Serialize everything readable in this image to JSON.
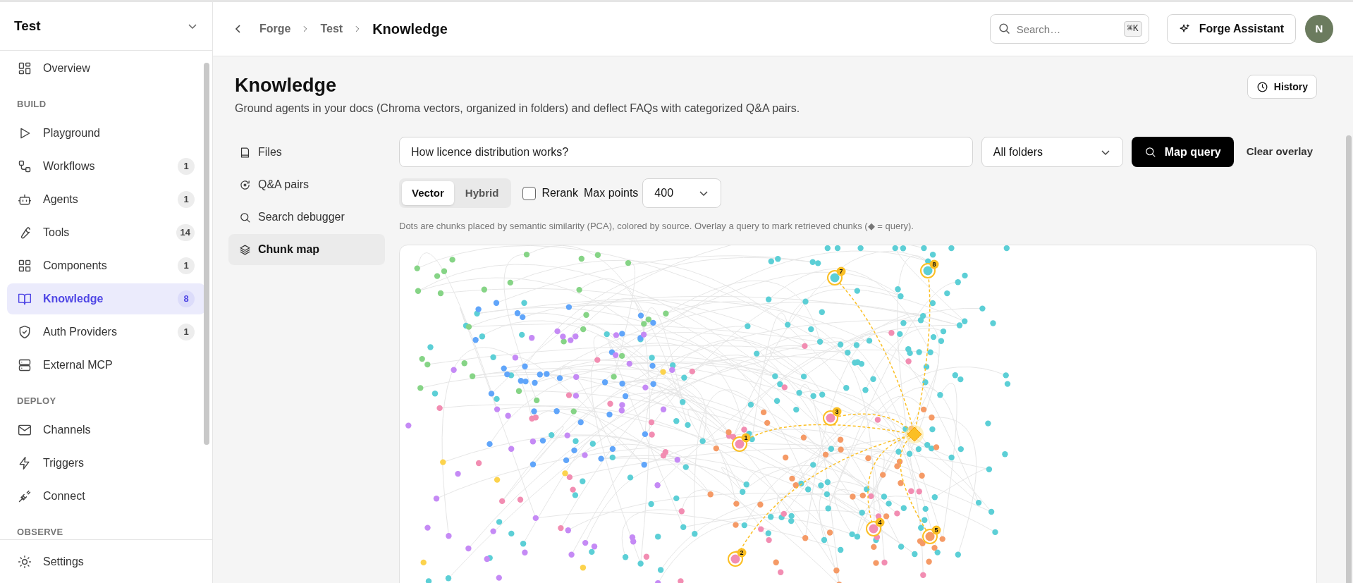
{
  "sidebar": {
    "workspace": "Test",
    "nav": [
      {
        "kind": "item",
        "label": "Overview",
        "selected": false
      },
      {
        "kind": "section",
        "label": "BUILD"
      },
      {
        "kind": "item",
        "label": "Playground",
        "selected": false
      },
      {
        "kind": "item",
        "label": "Workflows",
        "badge": "1",
        "selected": false
      },
      {
        "kind": "item",
        "label": "Agents",
        "badge": "1",
        "selected": false
      },
      {
        "kind": "item",
        "label": "Tools",
        "badge": "14",
        "selected": false
      },
      {
        "kind": "item",
        "label": "Components",
        "badge": "1",
        "selected": false
      },
      {
        "kind": "item",
        "label": "Knowledge",
        "badge": "8",
        "selected": true
      },
      {
        "kind": "item",
        "label": "Auth Providers",
        "badge": "1",
        "selected": false
      },
      {
        "kind": "item",
        "label": "External MCP",
        "selected": false
      },
      {
        "kind": "section",
        "label": "DEPLOY"
      },
      {
        "kind": "item",
        "label": "Channels",
        "selected": false
      },
      {
        "kind": "item",
        "label": "Triggers",
        "selected": false
      },
      {
        "kind": "item",
        "label": "Connect",
        "selected": false
      },
      {
        "kind": "section",
        "label": "OBSERVE"
      }
    ],
    "footer_item": {
      "label": "Settings"
    }
  },
  "header": {
    "breadcrumb": [
      "Forge",
      "Test",
      "Knowledge"
    ],
    "search": {
      "placeholder": "Search…",
      "shortcut": "⌘K"
    },
    "assistant_button": "Forge Assistant",
    "avatar": "N"
  },
  "page": {
    "title": "Knowledge",
    "description": "Ground agents in your docs (Chroma vectors, organized in folders) and deflect FAQs with categorized Q&A pairs.",
    "history_button": "History"
  },
  "tabs": [
    {
      "label": "Files",
      "selected": false
    },
    {
      "label": "Q&A pairs",
      "selected": false
    },
    {
      "label": "Search debugger",
      "selected": false
    },
    {
      "label": "Chunk map",
      "selected": true
    }
  ],
  "query": {
    "value": "How licence distribution works?",
    "folder": "All folders",
    "map_button": "Map query",
    "clear_button": "Clear overlay",
    "modes": [
      {
        "label": "Vector",
        "selected": true
      },
      {
        "label": "Hybrid",
        "selected": false
      }
    ],
    "rerank": {
      "label": "Rerank",
      "checked": false
    },
    "max_points": {
      "label": "Max points",
      "value": "400"
    },
    "hint": "Dots are chunks placed by semantic similarity (PCA), colored by source. Overlay a query to mark retrieved chunks (◆ = query)."
  },
  "chunk_map": {
    "hits": [
      {
        "label": "7",
        "color": "#5ccfd6"
      },
      {
        "label": "8",
        "color": "#5ccfd6"
      },
      {
        "label": "3",
        "color": "#f28db2"
      },
      {
        "label": "1",
        "color": "#f28db2"
      },
      {
        "label": "2",
        "color": "#f28db2"
      },
      {
        "label": "4",
        "color": "#f28db2"
      },
      {
        "label": "5",
        "color": "#f59a66"
      }
    ]
  }
}
